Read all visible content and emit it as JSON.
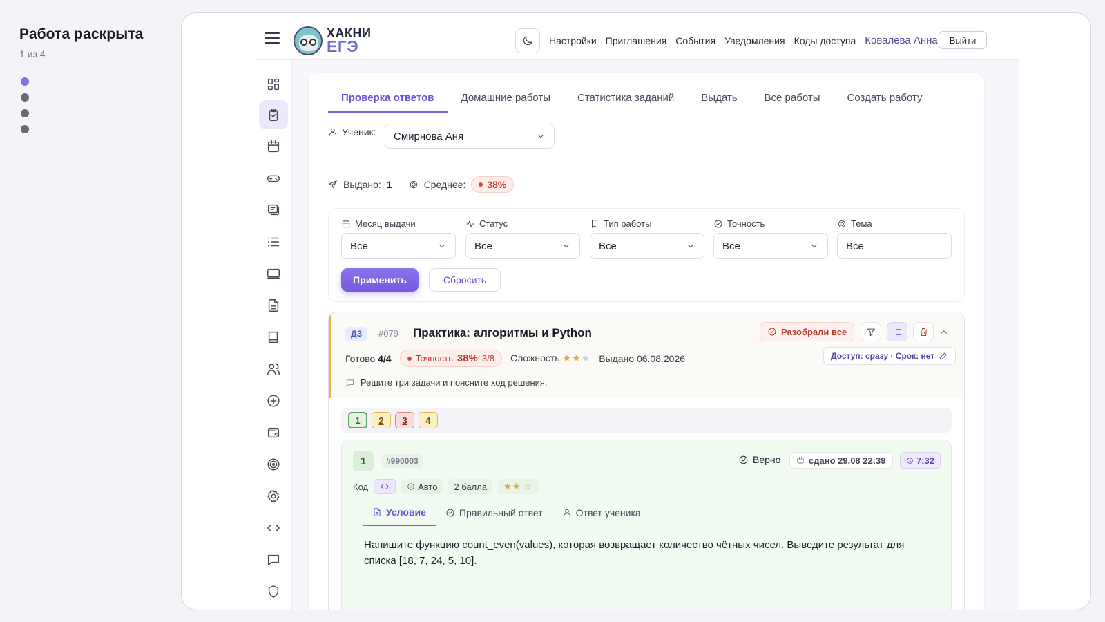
{
  "caption": {
    "title": "Работа раскрыта",
    "counter": "1 из 4",
    "steps": 4,
    "active_step": 1
  },
  "topbar": {
    "logo_line1": "ХАКНИ",
    "logo_line2": "ЕГЭ",
    "nav": [
      "Настройки",
      "Приглашения",
      "События",
      "Уведомления",
      "Коды доступа"
    ],
    "user": "Ковалева Анна",
    "logout": "Выйти"
  },
  "rail": [
    "dashboard-icon",
    "clipboard-check-icon",
    "calendar-icon",
    "gamepad-icon",
    "chat-list-icon",
    "list-icon",
    "monitor-icon",
    "document-icon",
    "book-icon",
    "users-icon",
    "plus-circle-icon",
    "wallet-icon",
    "target-icon",
    "gear-icon",
    "code-icon",
    "message-icon",
    "shield-icon"
  ],
  "tabs": [
    "Проверка ответов",
    "Домашние работы",
    "Статистика заданий",
    "Выдать",
    "Все работы",
    "Создать работу"
  ],
  "student": {
    "label": "Ученик:",
    "value": "Смирнова Аня"
  },
  "stats": {
    "issued_label": "Выдано:",
    "issued_value": "1",
    "avg_label": "Среднее:",
    "avg_value": "38%"
  },
  "filters": {
    "month": {
      "label": "Месяц выдачи",
      "value": "Все"
    },
    "status": {
      "label": "Статус",
      "value": "Все"
    },
    "type": {
      "label": "Тип работы",
      "value": "Все"
    },
    "accuracy": {
      "label": "Точность",
      "value": "Все"
    },
    "topic": {
      "label": "Тема",
      "value": "Все"
    },
    "apply": "Применить",
    "reset": "Сбросить"
  },
  "work": {
    "tag": "ДЗ",
    "number": "#079",
    "title": "Практика: алгоритмы и Python",
    "reviewed_btn": "Разобрали все",
    "ready_label": "Готово",
    "ready_value": "4/4",
    "accuracy_label": "Точность",
    "accuracy_value": "38%",
    "accuracy_score": "3/8",
    "difficulty_label": "Сложность",
    "difficulty_stars": 2,
    "difficulty_max": 3,
    "issued": "Выдано 06.08.2026",
    "access": "Доступ: сразу · Срок: нет",
    "note": "Решите три задачи и поясните ход решения.",
    "questions": [
      {
        "n": "1",
        "state": "correct"
      },
      {
        "n": "2",
        "state": "partial"
      },
      {
        "n": "3",
        "state": "wrong"
      },
      {
        "n": "4",
        "state": "partial"
      }
    ]
  },
  "task": {
    "number": "1",
    "id": "#990003",
    "status": "Верно",
    "submitted": "сдано 29.08 22:39",
    "time": "7:32",
    "kind": "Код",
    "check": "Авто",
    "points": "2 балла",
    "stars": 2,
    "stars_max": 3,
    "tabs": [
      "Условие",
      "Правильный ответ",
      "Ответ ученика"
    ],
    "text": "Напишите функцию count_even(values), которая возвращает количество чётных чисел. Выведите результат для списка [18, 7, 24, 5, 10]."
  }
}
